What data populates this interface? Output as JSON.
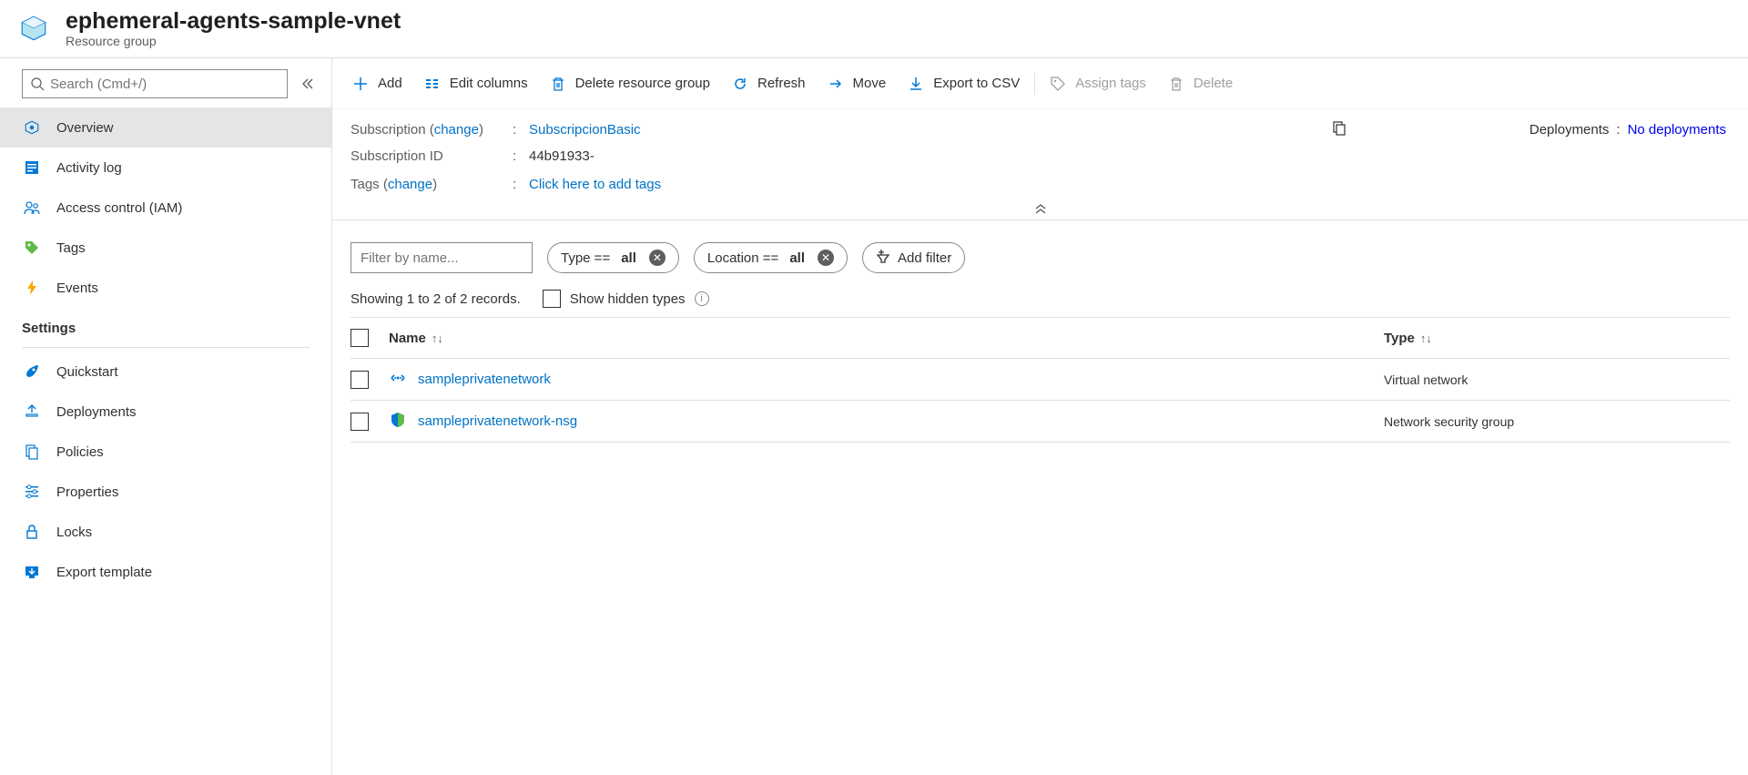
{
  "header": {
    "title": "ephemeral-agents-sample-vnet",
    "subtitle": "Resource group"
  },
  "sidebar": {
    "search_placeholder": "Search (Cmd+/)",
    "items": [
      {
        "label": "Overview",
        "active": true
      },
      {
        "label": "Activity log"
      },
      {
        "label": "Access control (IAM)"
      },
      {
        "label": "Tags"
      },
      {
        "label": "Events"
      }
    ],
    "settings_label": "Settings",
    "settings_items": [
      {
        "label": "Quickstart"
      },
      {
        "label": "Deployments"
      },
      {
        "label": "Policies"
      },
      {
        "label": "Properties"
      },
      {
        "label": "Locks"
      },
      {
        "label": "Export template"
      }
    ]
  },
  "cmdbar": {
    "add": "Add",
    "edit_columns": "Edit columns",
    "delete_rg": "Delete resource group",
    "refresh": "Refresh",
    "move": "Move",
    "export_csv": "Export to CSV",
    "assign_tags": "Assign tags",
    "delete": "Delete"
  },
  "essentials": {
    "subscription_label_pre": "Subscription (",
    "change_text": "change",
    "subscription_label_post": ")",
    "subscription_value": "SubscripcionBasic",
    "subscription_id_label": "Subscription ID",
    "subscription_id_value": "44b91933-",
    "tags_label_pre": "Tags (",
    "tags_label_post": ")",
    "tags_value": "Click here to add tags",
    "deployments_label": "Deployments",
    "deployments_value": "No deployments"
  },
  "filters": {
    "filter_placeholder": "Filter by name...",
    "type_label": "Type ==",
    "type_value": "all",
    "location_label": "Location ==",
    "location_value": "all",
    "add_filter": "Add filter"
  },
  "records": {
    "showing": "Showing 1 to 2 of 2 records.",
    "hidden_types": "Show hidden types"
  },
  "table": {
    "col_name": "Name",
    "col_type": "Type",
    "rows": [
      {
        "name": "sampleprivatenetwork",
        "type": "Virtual network"
      },
      {
        "name": "sampleprivatenetwork-nsg",
        "type": "Network security group"
      }
    ]
  }
}
